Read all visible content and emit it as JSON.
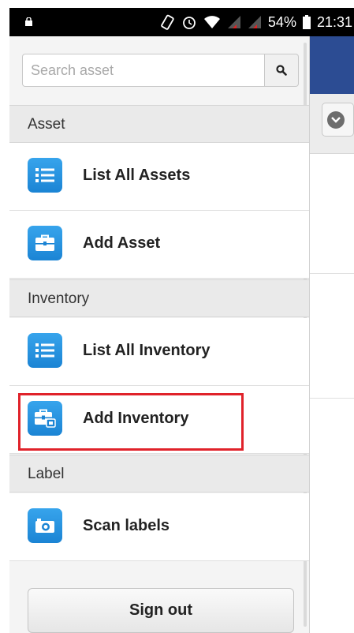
{
  "status_bar": {
    "battery": "54%",
    "time": "21:31"
  },
  "search": {
    "placeholder": "Search asset"
  },
  "sections": {
    "asset": "Asset",
    "inventory": "Inventory",
    "label": "Label"
  },
  "menu": {
    "list_all_assets": "List All Assets",
    "add_asset": "Add Asset",
    "list_all_inventory": "List All Inventory",
    "add_inventory": "Add Inventory",
    "scan_labels": "Scan labels"
  },
  "sign_out": "Sign out",
  "colors": {
    "accent": "#1b84d4",
    "header": "#2c4c93",
    "highlight": "#e0222a"
  }
}
